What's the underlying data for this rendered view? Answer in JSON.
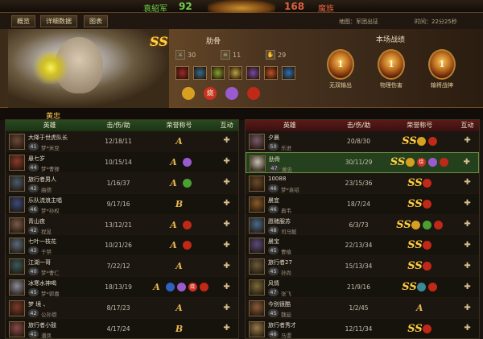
{
  "top": {
    "team_left": "袁紹军",
    "score_left": "92",
    "logo_text": "",
    "score_right": "168",
    "team_right": "魔族"
  },
  "tabs": [
    "概览",
    "详细数据",
    "图表"
  ],
  "map_info": "地图：军团出征",
  "time_info": "时间：22分25秒",
  "hero": {
    "grade": "SS",
    "name": "肋骨",
    "kills": "30",
    "deaths": "11",
    "assists": "29",
    "kill_icon": "swords-icon",
    "death_icon": "skull-icon",
    "assist_icon": "helping-hand-icon",
    "items": [
      {
        "name": "item-1",
        "color": "#a02828"
      },
      {
        "name": "item-2",
        "color": "#3a6a8a"
      },
      {
        "name": "item-3",
        "color": "#8aa030"
      },
      {
        "name": "item-4",
        "color": "#c0a040"
      },
      {
        "name": "item-5",
        "color": "#7a4aa0"
      },
      {
        "name": "item-6",
        "color": "#c05028"
      },
      {
        "name": "item-7",
        "color": "#3070b0"
      }
    ],
    "honors": [
      {
        "label": "",
        "color": "#d8a020"
      },
      {
        "label": "烧",
        "color": "#d03020"
      },
      {
        "label": "",
        "color": "#9a5ad0"
      },
      {
        "label": "",
        "color": "#c02818"
      }
    ]
  },
  "records": {
    "title": "本场战绩",
    "items": [
      {
        "medal": "1",
        "label": "无双输出"
      },
      {
        "medal": "1",
        "label": "物理伤害"
      },
      {
        "medal": "1",
        "label": "输将战神"
      }
    ]
  },
  "selected_player": "黄忠",
  "table_headers": {
    "hero": "英雄",
    "kda": "击/伤/助",
    "honor": "荣誉称号",
    "action": "互动"
  },
  "left_team": [
    {
      "name": "大降于世虎队长",
      "level": "41",
      "sub": "梦*米豆",
      "kda": "12/18/11",
      "grade": "A",
      "badges": [],
      "avatar": "#6a4a3a"
    },
    {
      "name": "悬七岁",
      "level": "44",
      "sub": "梦*曹操",
      "kda": "10/15/14",
      "grade": "A",
      "badges": [
        {
          "label": "",
          "color": "#9a5ad0"
        }
      ],
      "avatar": "#8a3a2a"
    },
    {
      "name": "旅行者男人",
      "level": "42",
      "sub": "曲德",
      "kda": "1/16/37",
      "grade": "A",
      "badges": [
        {
          "label": "",
          "color": "#4aa030"
        }
      ],
      "avatar": "#4a5a6a"
    },
    {
      "name": "乐队流浪主唱",
      "level": "46",
      "sub": "梦*孙权",
      "kda": "9/17/16",
      "grade": "B",
      "badges": [],
      "avatar": "#3a4a7a"
    },
    {
      "name": "青山夜",
      "level": "42",
      "sub": "程昱",
      "kda": "13/12/21",
      "grade": "A",
      "badges": [
        {
          "label": "",
          "color": "#c02818"
        }
      ],
      "avatar": "#7a5a4a"
    },
    {
      "name": "七叶一枝花",
      "level": "42",
      "sub": "于禁",
      "kda": "10/21/26",
      "grade": "A",
      "badges": [
        {
          "label": "",
          "color": "#c02818"
        }
      ],
      "avatar": "#5a6a7a"
    },
    {
      "name": "江湖一哥",
      "level": "40",
      "sub": "梦*曹仁",
      "kda": "7/22/12",
      "grade": "A",
      "badges": [],
      "avatar": "#3a5a5a"
    },
    {
      "name": "冰寒水神喝",
      "level": "45",
      "sub": "梦*郭嘉",
      "kda": "18/13/19",
      "grade": "A",
      "badges": [
        {
          "label": "",
          "color": "#3060c0"
        },
        {
          "label": "",
          "color": "#9a5ad0"
        },
        {
          "label": "烧",
          "color": "#d03020"
        },
        {
          "label": "",
          "color": "#c02818"
        }
      ],
      "avatar": "#8a8a9a"
    },
    {
      "name": "梦 境 、",
      "level": "42",
      "sub": "公孙瓒",
      "kda": "8/17/23",
      "grade": "A",
      "badges": [],
      "avatar": "#7a3a2a"
    },
    {
      "name": "旅行者小鼓",
      "level": "41",
      "sub": "潘凤",
      "kda": "4/17/24",
      "grade": "B",
      "badges": [],
      "avatar": "#8a4a4a"
    }
  ],
  "right_team": [
    {
      "name": "夕晨",
      "level": "50",
      "sub": "乐进",
      "kda": "20/8/30",
      "grade": "SS",
      "badges": [
        {
          "label": "",
          "color": "#d8a020"
        },
        {
          "label": "",
          "color": "#c02818"
        }
      ],
      "avatar": "#7a5a6a",
      "selected": false
    },
    {
      "name": "肋骨",
      "level": "47",
      "sub": "黄忠",
      "kda": "30/11/29",
      "grade": "SS",
      "badges": [
        {
          "label": "",
          "color": "#d8a020"
        },
        {
          "label": "烧",
          "color": "#d03020"
        },
        {
          "label": "",
          "color": "#9a5ad0"
        },
        {
          "label": "",
          "color": "#c02818"
        }
      ],
      "avatar": "#c8c0b0",
      "selected": true
    },
    {
      "name": "10088",
      "level": "46",
      "sub": "梦*袁绍",
      "kda": "23/15/36",
      "grade": "SS",
      "badges": [
        {
          "label": "",
          "color": "#c02818"
        }
      ],
      "avatar": "#6a4a2a",
      "selected": false
    },
    {
      "name": "晨宜",
      "level": "46",
      "sub": "典韦",
      "kda": "18/7/24",
      "grade": "SS",
      "badges": [
        {
          "label": "",
          "color": "#c02818"
        }
      ],
      "avatar": "#8a5a2a",
      "selected": false
    },
    {
      "name": "愿赌服苏",
      "level": "48",
      "sub": "司马懿",
      "kda": "6/3/73",
      "grade": "SS",
      "badges": [
        {
          "label": "",
          "color": "#d8a020"
        },
        {
          "label": "",
          "color": "#4aa030"
        },
        {
          "label": "",
          "color": "#c02818"
        }
      ],
      "avatar": "#4a6a8a",
      "selected": false
    },
    {
      "name": "晨宝",
      "level": "45",
      "sub": "曹植",
      "kda": "22/13/34",
      "grade": "SS",
      "badges": [
        {
          "label": "",
          "color": "#c02818"
        }
      ],
      "avatar": "#5a4a7a",
      "selected": false
    },
    {
      "name": "旅行者27",
      "level": "45",
      "sub": "孙尚",
      "kda": "15/13/34",
      "grade": "SS",
      "badges": [
        {
          "label": "",
          "color": "#c02818"
        }
      ],
      "avatar": "#6a5a3a",
      "selected": false
    },
    {
      "name": "风情",
      "level": "47",
      "sub": "张飞",
      "kda": "21/9/16",
      "grade": "SS",
      "badges": [
        {
          "label": "",
          "color": "#3a8a9a"
        },
        {
          "label": "",
          "color": "#c02818"
        }
      ],
      "avatar": "#7a6a3a",
      "selected": false
    },
    {
      "name": "今别很酷",
      "level": "45",
      "sub": "魏延",
      "kda": "1/2/45",
      "grade": "A",
      "badges": [],
      "avatar": "#8a5a3a",
      "selected": false
    },
    {
      "name": "旅行者秀才",
      "level": "46",
      "sub": "马谡",
      "kda": "12/11/34",
      "grade": "SS",
      "badges": [
        {
          "label": "",
          "color": "#c02818"
        }
      ],
      "avatar": "#9a7a4a",
      "selected": false
    }
  ]
}
